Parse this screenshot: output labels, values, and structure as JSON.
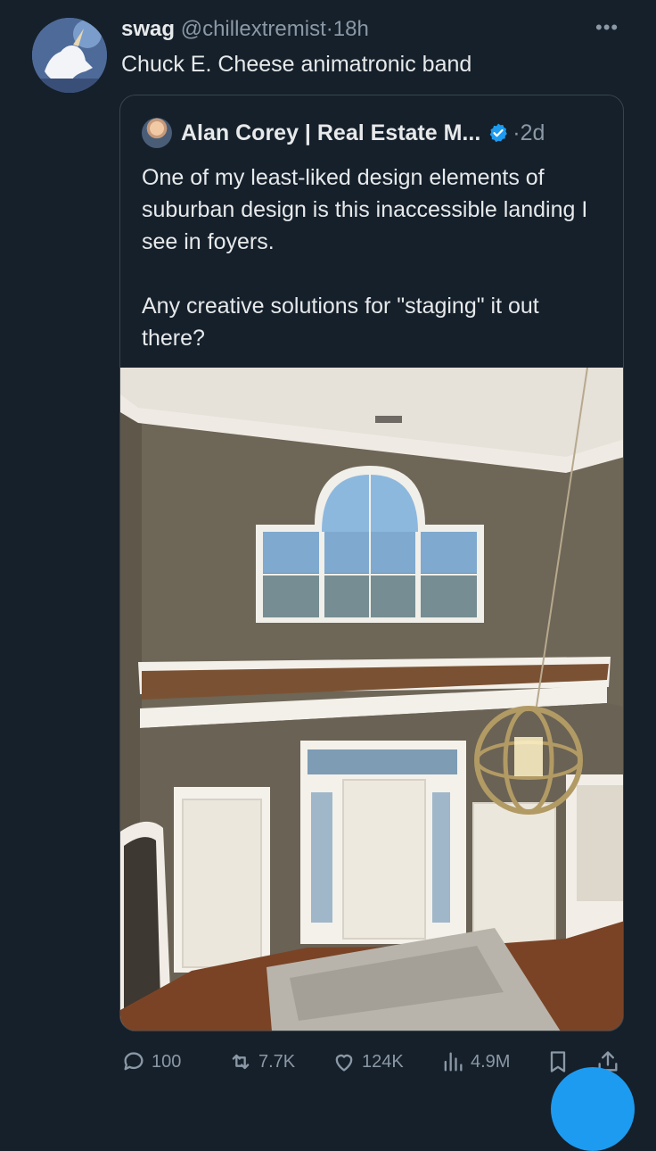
{
  "tweet": {
    "author_name": "swag",
    "author_handle": "@chillextremist",
    "separator": "·",
    "time": "18h",
    "text": "Chuck E. Cheese animatronic band"
  },
  "quoted": {
    "author_name": "Alan Corey | Real Estate M...",
    "verified": true,
    "separator": "·",
    "time": "2d",
    "text": "One of my least-liked design elements of suburban design is this inaccessible landing I see in foyers.\n\nAny creative solutions for \"staging\" it out there?"
  },
  "actions": {
    "replies": "100",
    "reposts": "7.7K",
    "likes": "124K",
    "views": "4.9M"
  },
  "colors": {
    "background": "#15202b",
    "text": "#e7e9ea",
    "muted": "#8b98a5",
    "accent": "#1d9bf0",
    "border": "#38444d"
  },
  "icons": [
    "more-icon",
    "verified-icon",
    "reply-icon",
    "repost-icon",
    "like-icon",
    "views-icon",
    "bookmark-icon",
    "share-icon"
  ]
}
